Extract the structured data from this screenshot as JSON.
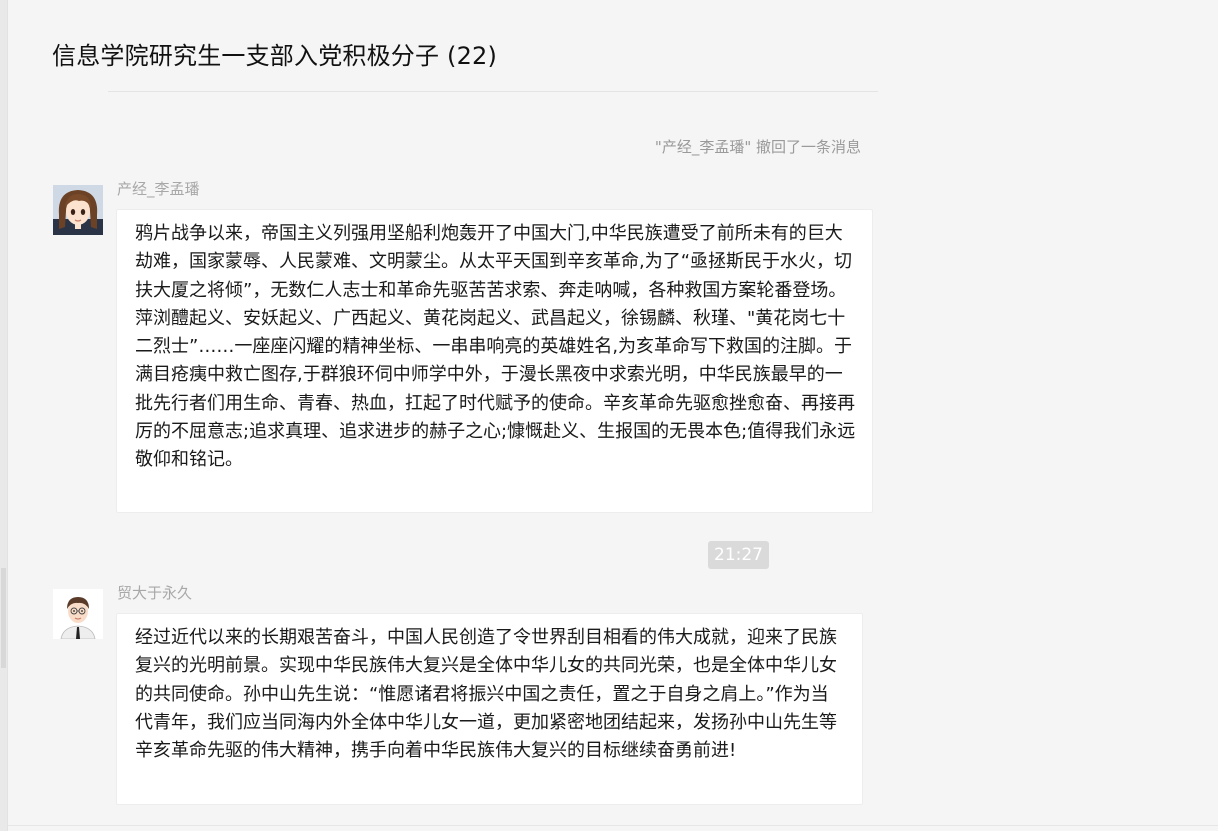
{
  "header": {
    "title": "信息学院研究生一支部入党积极分子 (22)"
  },
  "chat": {
    "system_notice": "\"产经_李孟璠\" 撤回了一条消息",
    "time_divider": "21:27",
    "messages": [
      {
        "sender": "产经_李孟璠",
        "avatar_icon": "anime-girl-avatar",
        "text": "鸦片战争以来，帝国主义列强用坚船利炮轰开了中国大门,中华民族遭受了前所未有的巨大劫难，国家蒙辱、人民蒙难、文明蒙尘。从太平天国到辛亥革命,为了“亟拯斯民于水火，切扶大厦之将倾”，无数仁人志士和革命先驱苦苦求索、奔走呐喊，各种救国方案轮番登场。萍浏醴起义、安妖起义、广西起义、黄花岗起义、武昌起义，徐锡麟、秋瑾、\"黄花岗七十二烈士”……一座座闪耀的精神坐标、一串串响亮的英雄姓名,为亥革命写下救国的注脚。于满目疮痍中救亡图存,于群狼环伺中师学中外，于漫长黑夜中求索光明，中华民族最早的一批先行者们用生命、青春、热血，扛起了时代赋予的使命。辛亥革命先驱愈挫愈奋、再接再厉的不屈意志;追求真理、追求进步的赫子之心;慷慨赴义、生报国的无畏本色;值得我们永远敬仰和铭记。"
      },
      {
        "sender": "贸大于永久",
        "avatar_icon": "cartoon-man-avatar",
        "text": "经过近代以来的长期艰苦奋斗，中国人民创造了令世界刮目相看的伟大成就，迎来了民族复兴的光明前景。实现中华民族伟大复兴是全体中华儿女的共同光荣，也是全体中华儿女的共同使命。孙中山先生说：“惟愿诸君将振兴中国之责任，置之于自身之肩上。”作为当代青年，我们应当同海内外全体中华儿女一道，更加紧密地团结起来，发扬孙中山先生等辛亥革命先驱的伟大精神，携手向着中华民族伟大复兴的目标继续奋勇前进!"
      }
    ]
  },
  "colors": {
    "background": "#f5f5f5",
    "bubble": "#ffffff",
    "time_chip": "#dadada",
    "muted_text": "#a8a8a8"
  }
}
